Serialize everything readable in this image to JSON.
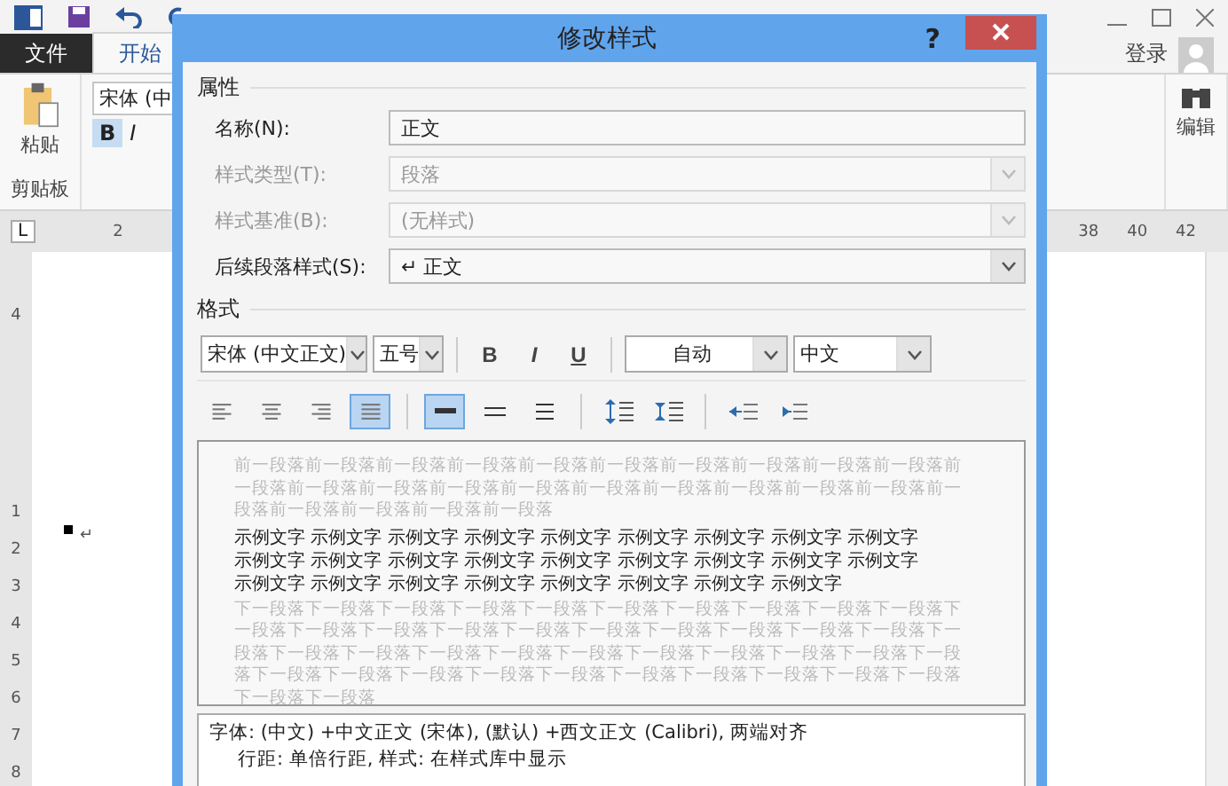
{
  "app": {
    "login": "登录"
  },
  "ribbon_tabs": [
    {
      "label": "文件",
      "kind": "file",
      "selected": false
    },
    {
      "label": "开始",
      "kind": "normal",
      "selected": true
    }
  ],
  "ribbon": {
    "paste": "粘贴",
    "clipboard_group": "剪贴板",
    "font_name": "宋体 (中",
    "bold": "B",
    "italic": "I",
    "editing": "编辑"
  },
  "ruler": {
    "corner": "L",
    "left_ticks": [
      "2"
    ],
    "right_ticks": [
      "38",
      "40",
      "42"
    ]
  },
  "vertical_ruler": [
    "4",
    "1",
    "2",
    "3",
    "4",
    "5",
    "6",
    "7",
    "8"
  ],
  "document": {
    "return_mark": "↵"
  },
  "dialog": {
    "title": "修改样式",
    "help": "?",
    "properties_heading": "属性",
    "fields": [
      {
        "label": "名称(N):",
        "value": "正文",
        "kind": "text",
        "disabled": false
      },
      {
        "label": "样式类型(T):",
        "value": "段落",
        "kind": "select",
        "disabled": true
      },
      {
        "label": "样式基准(B):",
        "value": "(无样式)",
        "kind": "select",
        "disabled": true
      },
      {
        "label": "后续段落样式(S):",
        "value": "↵ 正文",
        "kind": "select",
        "disabled": false
      }
    ],
    "format_heading": "格式",
    "font": {
      "name": "宋体 (中文正文)",
      "size": "五号",
      "bold": "B",
      "italic": "I",
      "underline": "U",
      "font_color": "自动",
      "script": "中文"
    },
    "paragraph_buttons": [
      {
        "kind": "align-left",
        "selected": false
      },
      {
        "kind": "align-center",
        "selected": false
      },
      {
        "kind": "align-right",
        "selected": false
      },
      {
        "kind": "justify",
        "selected": true
      },
      {
        "kind": "single-spacing",
        "selected": true
      },
      {
        "kind": "one-half-spacing",
        "selected": false
      },
      {
        "kind": "double-spacing",
        "selected": false
      },
      {
        "kind": "space-increase",
        "selected": false
      },
      {
        "kind": "space-decrease",
        "selected": false
      },
      {
        "kind": "indent-decrease",
        "selected": false
      },
      {
        "kind": "indent-increase",
        "selected": false
      }
    ],
    "preview": {
      "previous": "前一段落前一段落前一段落前一段落前一段落前一段落前一段落前一段落前一段落前一段落前一段落前一段落前一段落前一段落前一段落前一段落前一段落前一段落前一段落前一段落前一段落前一段落前一段落前一段落前一段落",
      "sample": [
        "示例文字 示例文字 示例文字 示例文字 示例文字 示例文字 示例文字 示例文字 示例文字",
        "示例文字 示例文字 示例文字 示例文字 示例文字 示例文字 示例文字 示例文字 示例文字",
        "示例文字 示例文字 示例文字 示例文字 示例文字 示例文字 示例文字 示例文字"
      ],
      "next": "下一段落下一段落下一段落下一段落下一段落下一段落下一段落下一段落下一段落下一段落下一段落下一段落下一段落下一段落下一段落下一段落下一段落下一段落下一段落下一段落下一段落下一段落下一段落下一段落下一段落下一段落下一段落下一段落下一段落下一段落下一段落下一段落下一段落下一段落下一段落下一段落下一段落下一段落下一段落下一段落下一段落下一段落下一段落"
    },
    "description": [
      "字体: (中文) +中文正文 (宋体), (默认) +西文正文 (Calibri), 两端对齐",
      "行距: 单倍行距, 样式: 在样式库中显示"
    ]
  }
}
